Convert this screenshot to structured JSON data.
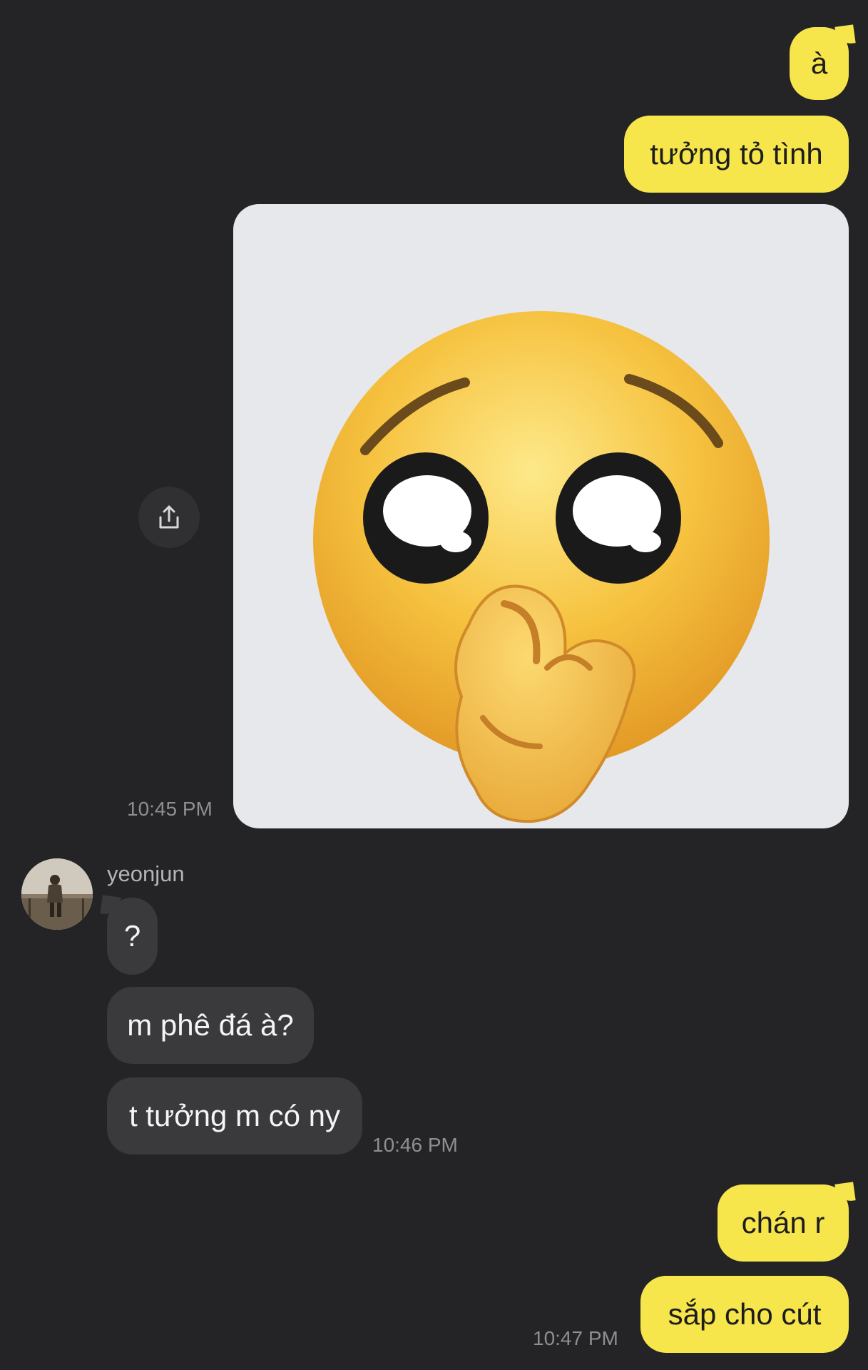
{
  "messages_outgoing_top": [
    {
      "text": "à"
    },
    {
      "text": "tưởng tỏ tình"
    }
  ],
  "sticker": {
    "icon": "pleading-face-hand-over-mouth-emoji"
  },
  "share_button": {
    "icon": "share-icon"
  },
  "time_1": "10:45 PM",
  "contact": {
    "name": "yeonjun",
    "avatar": "avatar-photo"
  },
  "messages_incoming": [
    {
      "text": "?"
    },
    {
      "text": "m phê đá à?"
    },
    {
      "text": "t tưởng m có ny"
    }
  ],
  "time_2": "10:46 PM",
  "messages_outgoing_bottom": [
    {
      "text": "chán r"
    },
    {
      "text": "sắp cho cút"
    }
  ],
  "time_3": "10:47 PM",
  "colors": {
    "background": "#242426",
    "outgoing_bubble": "#f6e54b",
    "incoming_bubble": "#3a3a3d",
    "timestamp": "#8e8e93"
  }
}
